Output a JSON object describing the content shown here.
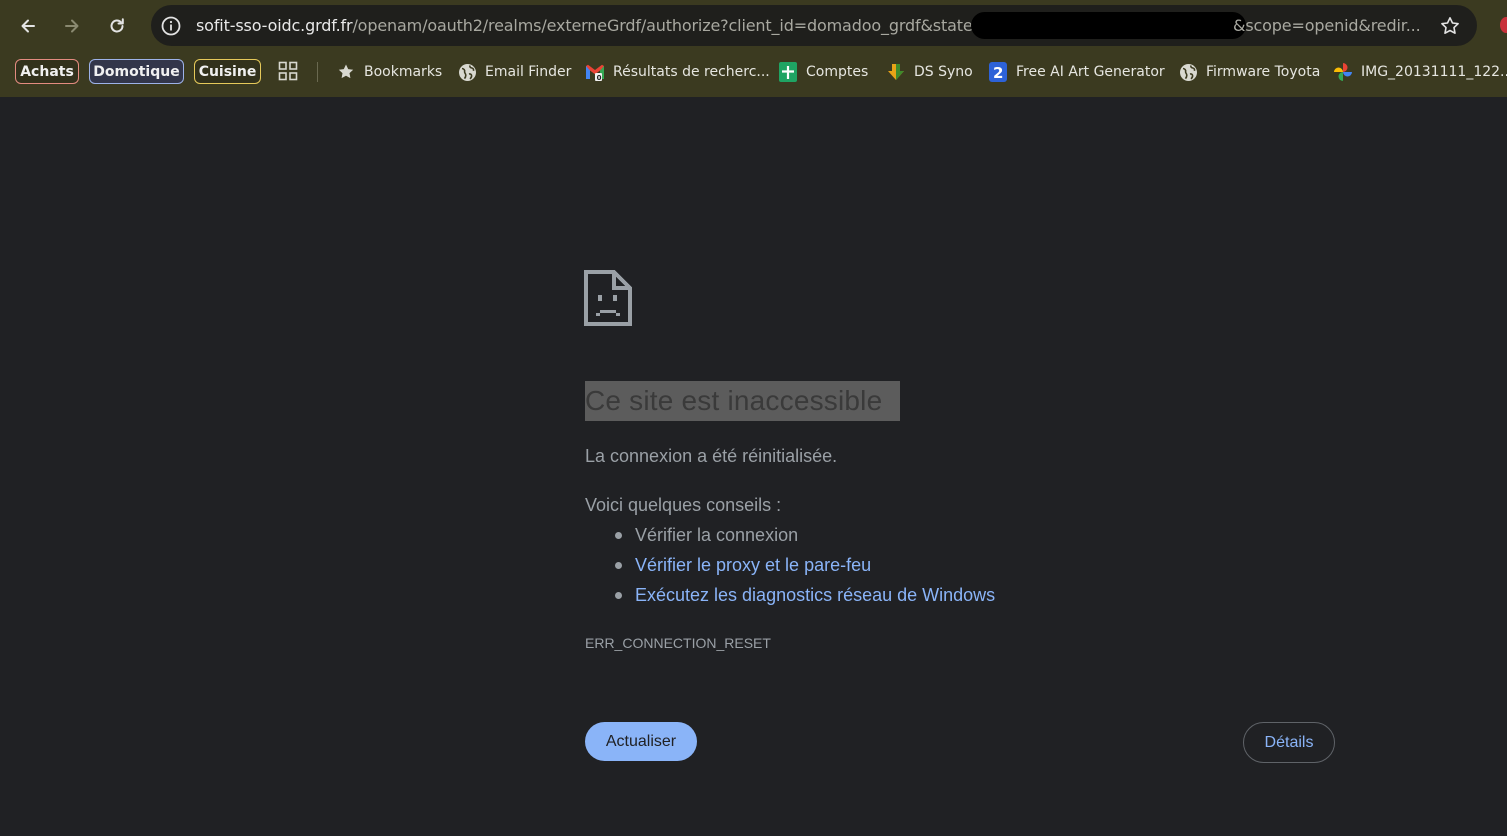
{
  "browser": {
    "url_host": "sofit-sso-oidc.grdf.fr",
    "url_path": "/openam/oauth2/realms/externeGrdf/authorize?client_id=domadoo_grdf&state=",
    "url_tail": "&scope=openid&redir...",
    "icons": {
      "back": "arrow-left-icon",
      "forward": "arrow-right-icon",
      "reload": "reload-icon",
      "site_info": "info-icon",
      "bookmark_star": "star-icon"
    }
  },
  "bookmarks_bar": {
    "groups": [
      {
        "label": "Achats",
        "color": "#e38b80"
      },
      {
        "label": "Domotique",
        "color": "#9db2e8"
      },
      {
        "label": "Cuisine",
        "color": "#e6c95a"
      }
    ],
    "items": [
      {
        "label": "Bookmarks",
        "icon": "star-icon"
      },
      {
        "label": "Email Finder",
        "icon": "globe-icon"
      },
      {
        "label": "Résultats de recherc...",
        "icon": "gmail-icon"
      },
      {
        "label": "Comptes",
        "icon": "sheets-icon"
      },
      {
        "label": "DS Syno",
        "icon": "download-icon"
      },
      {
        "label": "Free AI Art Generator",
        "icon": "number-two-icon"
      },
      {
        "label": "Firmware Toyota",
        "icon": "globe-icon"
      },
      {
        "label": "IMG_20131111_122...",
        "icon": "photos-icon"
      }
    ]
  },
  "error_page": {
    "title": "Ce site est inaccessible",
    "description": "La connexion a été réinitialisée.",
    "tips_heading": "Voici quelques conseils :",
    "tips": [
      {
        "label": "Vérifier la connexion",
        "link": false
      },
      {
        "label": "Vérifier le proxy et le pare-feu",
        "link": true
      },
      {
        "label": "Exécutez les diagnostics réseau de Windows",
        "link": true
      }
    ],
    "error_code": "ERR_CONNECTION_RESET",
    "reload_button": "Actualiser",
    "details_button": "Détails",
    "accent_color": "#8ab4f8"
  }
}
